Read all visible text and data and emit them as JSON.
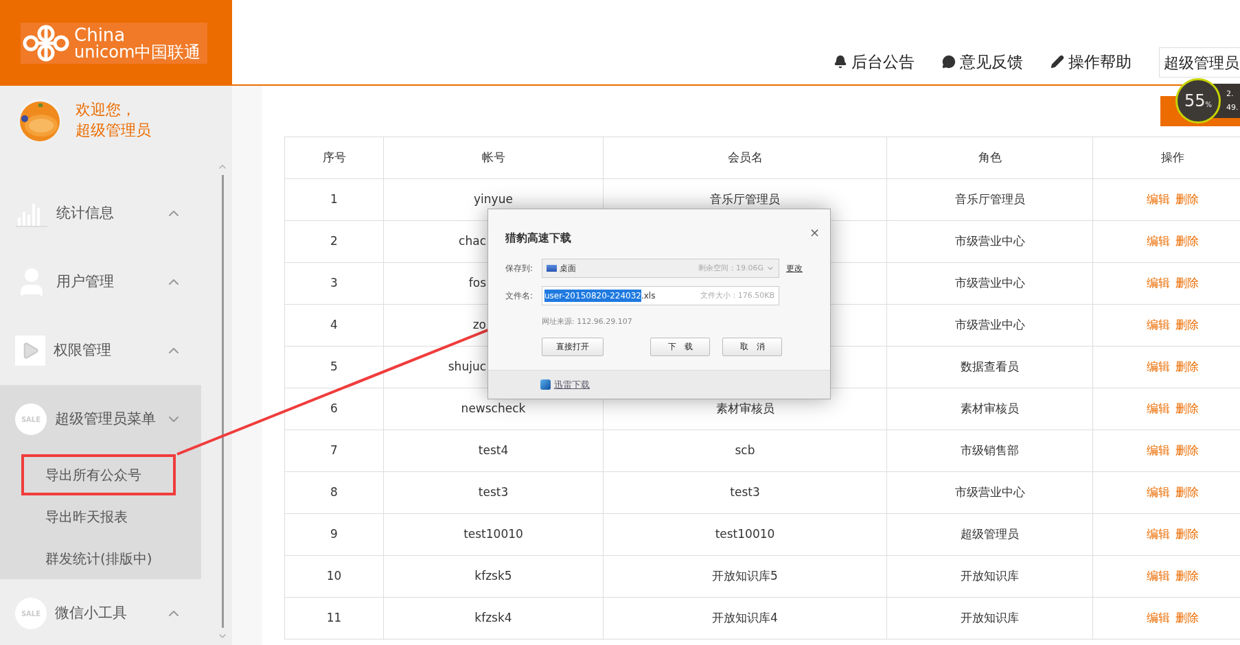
{
  "logo": {
    "line1": "China",
    "line2": "unicom中国联通"
  },
  "header": {
    "nav": [
      {
        "kind": "bell",
        "label": "后台公告"
      },
      {
        "kind": "chat",
        "label": "意见反馈"
      },
      {
        "kind": "pencil",
        "label": "操作帮助"
      }
    ],
    "user_box": "超级管理员"
  },
  "sidebar": {
    "welcome": [
      "欢迎您，",
      "超级管理员"
    ],
    "items": [
      {
        "kind": "chart",
        "label": "统计信息",
        "expanded": false
      },
      {
        "kind": "user",
        "label": "用户管理",
        "expanded": false
      },
      {
        "kind": "play",
        "label": "权限管理",
        "expanded": false
      },
      {
        "kind": "sale",
        "badge_text": "SALE",
        "label": "超级管理员菜单",
        "expanded": true,
        "children": [
          {
            "label": "导出所有公众号",
            "annotated": true
          },
          {
            "label": "导出昨天报表",
            "annotated": false
          },
          {
            "label": "群发统计(排版中)",
            "annotated": false
          }
        ]
      },
      {
        "kind": "sale",
        "badge_text": "SALE",
        "label": "微信小工具",
        "expanded": false
      }
    ]
  },
  "speed_widget": {
    "percent": "55",
    "unit": "%",
    "up": "2.",
    "down": "49."
  },
  "table": {
    "columns": [
      "序号",
      "帐号",
      "会员名",
      "角色",
      "操作"
    ],
    "rows": [
      {
        "no": "1",
        "account": "yinyue",
        "member": "音乐厅管理员",
        "role": "音乐厅管理员",
        "actions": [
          "编辑",
          "删除"
        ]
      },
      {
        "no": "2",
        "account": "chac",
        "account_covered": true,
        "role": "市级营业中心",
        "actions": [
          "编辑",
          "删除"
        ]
      },
      {
        "no": "3",
        "account": "fos",
        "account_covered": true,
        "role": "市级营业中心",
        "actions": [
          "编辑",
          "删除"
        ]
      },
      {
        "no": "4",
        "account": "zo",
        "account_covered": true,
        "role": "市级营业中心",
        "actions": [
          "编辑",
          "删除"
        ]
      },
      {
        "no": "5",
        "account": "shujuc",
        "account_covered": true,
        "role": "数据查看员",
        "actions": [
          "编辑",
          "删除"
        ]
      },
      {
        "no": "6",
        "account": "newscheck",
        "member": "素材审核员",
        "role": "素材审核员",
        "actions": [
          "编辑",
          "删除"
        ]
      },
      {
        "no": "7",
        "account": "test4",
        "member": "scb",
        "role": "市级销售部",
        "actions": [
          "编辑",
          "删除"
        ]
      },
      {
        "no": "8",
        "account": "test3",
        "member": "test3",
        "role": "市级营业中心",
        "actions": [
          "编辑",
          "删除"
        ]
      },
      {
        "no": "9",
        "account": "test10010",
        "member": "test10010",
        "role": "超级管理员",
        "actions": [
          "编辑",
          "删除"
        ]
      },
      {
        "no": "10",
        "account": "kfzsk5",
        "member": "开放知识库5",
        "role": "开放知识库",
        "actions": [
          "编辑",
          "删除"
        ]
      },
      {
        "no": "11",
        "account": "kfzsk4",
        "member": "开放知识库4",
        "role": "开放知识库",
        "actions": [
          "编辑",
          "删除"
        ]
      }
    ]
  },
  "dialog": {
    "title": "猎豹高速下载",
    "close": "×",
    "save_label": "保存到:",
    "save_folder": "桌面",
    "free_space": "剩余空间：19.06G",
    "change_link": "更改",
    "file_label": "文件名:",
    "file_selected": "user-20150820-224032",
    "file_ext": ".xls",
    "file_size": "文件大小：176.50KB",
    "source": "网址来源: 112.96.29.107",
    "buttons": [
      "直接打开",
      "下　载",
      "取　消"
    ],
    "footer_link": "迅雷下载"
  }
}
